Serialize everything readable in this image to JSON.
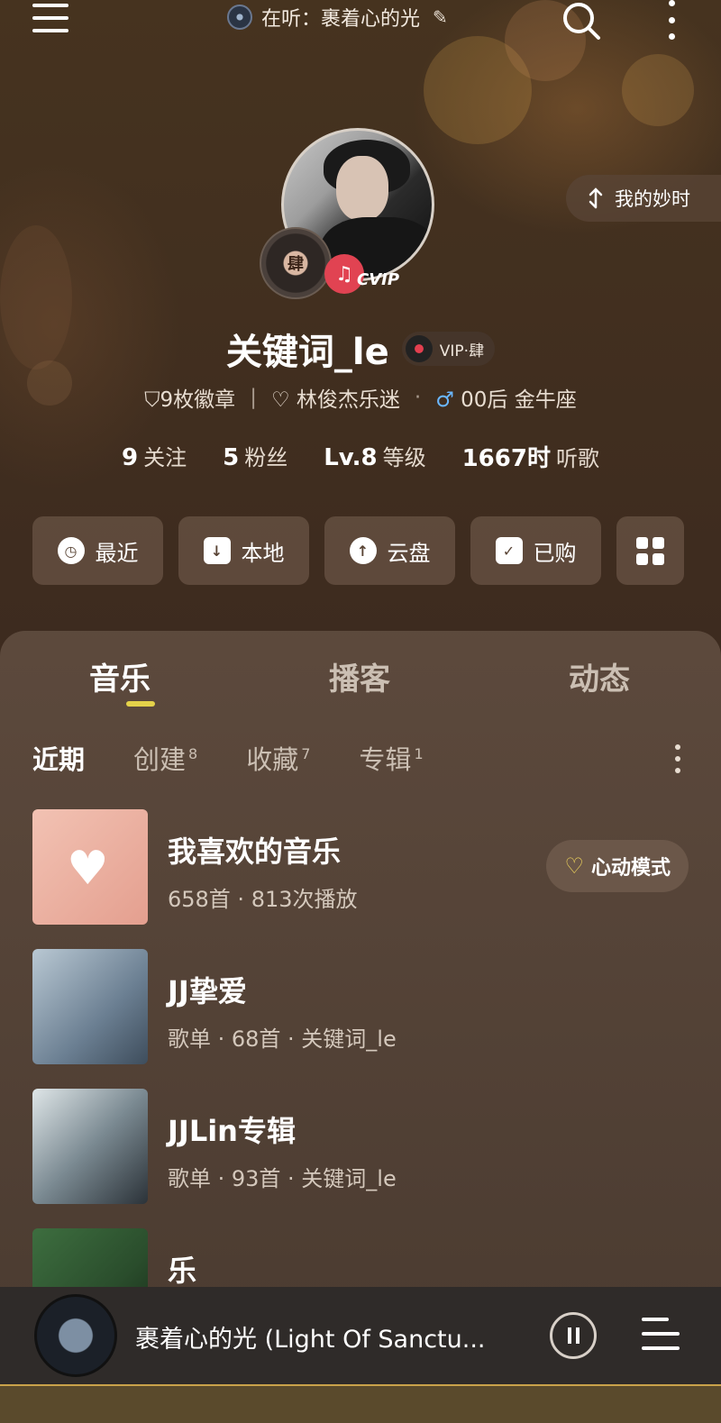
{
  "top_bar": {
    "now_playing_label": "在听：裹着心的光",
    "icons": [
      "menu-icon",
      "search-icon",
      "more-icon",
      "edit-icon"
    ]
  },
  "moment_button": {
    "label": "我的妙时"
  },
  "profile": {
    "vip_level_badge": "肆",
    "cvip_label": "CVIP",
    "username": "关键词_le",
    "vip_tag": "VIP·肆",
    "badges": "9枚徽章",
    "fan_tag": "林俊杰乐迷",
    "separator": "·",
    "demographic": "00后 金牛座",
    "stats": [
      {
        "value": "9",
        "label": "关注"
      },
      {
        "value": "5",
        "label": "粉丝"
      },
      {
        "value": "Lv.8",
        "label": "等级"
      },
      {
        "value": "1667时",
        "label": "听歌"
      }
    ]
  },
  "quick_actions": [
    {
      "label": "最近",
      "icon": "clock-icon"
    },
    {
      "label": "本地",
      "icon": "download-icon"
    },
    {
      "label": "云盘",
      "icon": "cloud-upload-icon"
    },
    {
      "label": "已购",
      "icon": "bag-icon"
    },
    {
      "label": "",
      "icon": "apps-grid-icon"
    }
  ],
  "tabs": [
    {
      "label": "音乐",
      "active": true
    },
    {
      "label": "播客",
      "active": false
    },
    {
      "label": "动态",
      "active": false
    }
  ],
  "subtabs": [
    {
      "label": "近期",
      "count": ""
    },
    {
      "label": "创建",
      "count": "8"
    },
    {
      "label": "收藏",
      "count": "7"
    },
    {
      "label": "专辑",
      "count": "1"
    }
  ],
  "playlists": [
    {
      "title": "我喜欢的音乐",
      "subtitle": "658首 · 813次播放"
    },
    {
      "title": "JJ挚爱",
      "subtitle": "歌单 · 68首 · 关键词_le"
    },
    {
      "title": "JJLin专辑",
      "subtitle": "歌单 · 93首 · 关键词_le"
    },
    {
      "title": "乐",
      "subtitle": ""
    }
  ],
  "heartbeat_button": {
    "label": "心动模式"
  },
  "player": {
    "title": "裹着心的光 (Light Of Sanctu...",
    "state": "playing"
  }
}
